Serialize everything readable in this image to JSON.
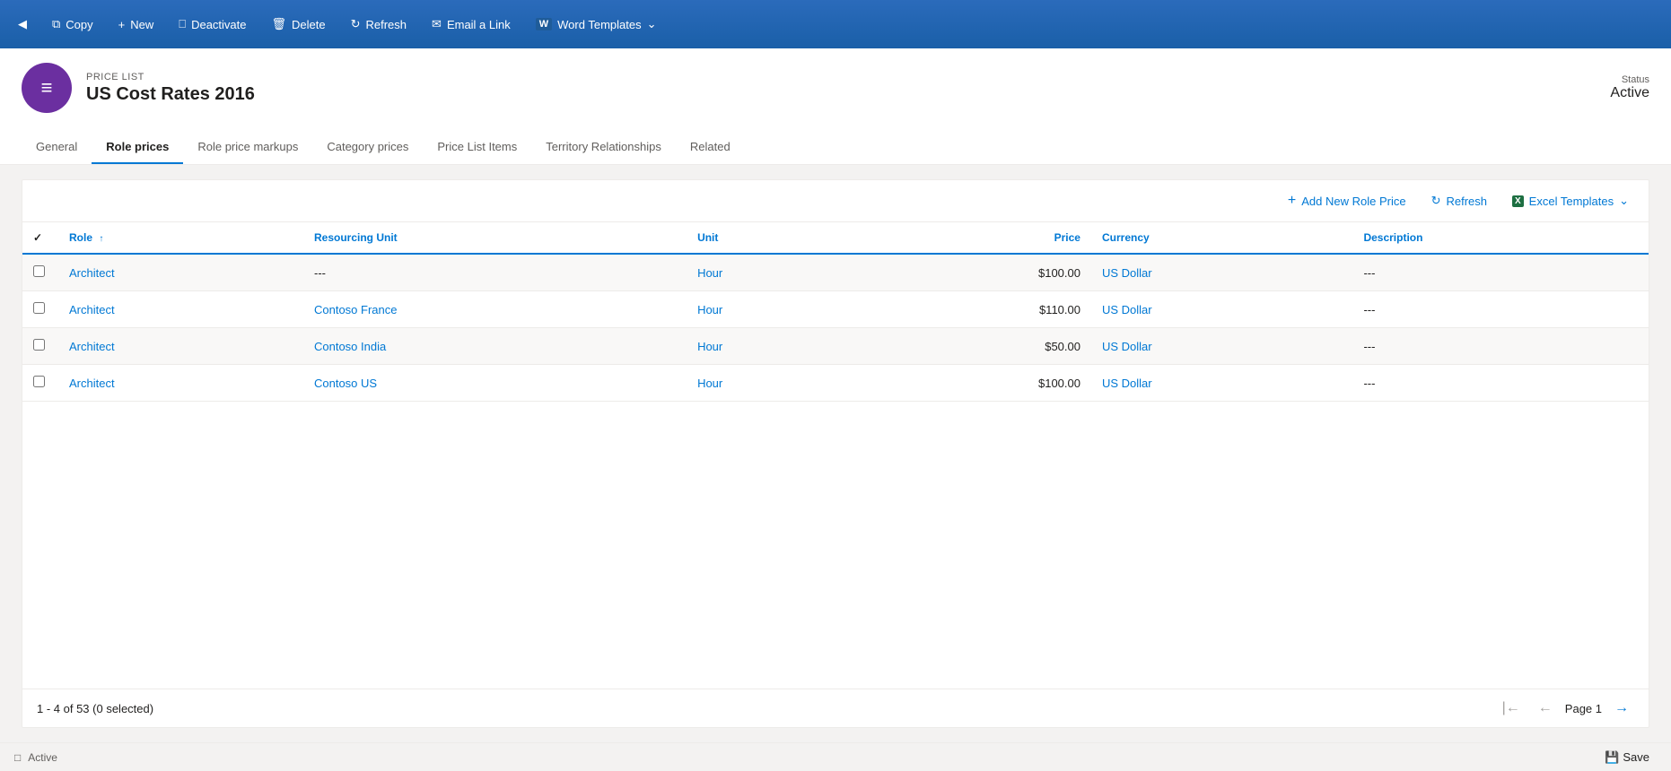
{
  "toolbar": {
    "items": [
      {
        "id": "copy",
        "label": "Copy",
        "icon": "⧉"
      },
      {
        "id": "new",
        "label": "New",
        "icon": "+"
      },
      {
        "id": "deactivate",
        "label": "Deactivate",
        "icon": "⊘"
      },
      {
        "id": "delete",
        "label": "Delete",
        "icon": "🗑"
      },
      {
        "id": "refresh",
        "label": "Refresh",
        "icon": "↺"
      },
      {
        "id": "email",
        "label": "Email a Link",
        "icon": "✉"
      },
      {
        "id": "word",
        "label": "Word Templates",
        "icon": "W"
      }
    ]
  },
  "record": {
    "type": "PRICE LIST",
    "title": "US Cost Rates 2016",
    "status_label": "Status",
    "status_value": "Active",
    "avatar_icon": "≡"
  },
  "tabs": [
    {
      "id": "general",
      "label": "General",
      "active": false
    },
    {
      "id": "role-prices",
      "label": "Role prices",
      "active": true
    },
    {
      "id": "role-price-markups",
      "label": "Role price markups",
      "active": false
    },
    {
      "id": "category-prices",
      "label": "Category prices",
      "active": false
    },
    {
      "id": "price-list-items",
      "label": "Price List Items",
      "active": false
    },
    {
      "id": "territory-relationships",
      "label": "Territory Relationships",
      "active": false
    },
    {
      "id": "related",
      "label": "Related",
      "active": false
    }
  ],
  "grid": {
    "toolbar": {
      "add_label": "Add New Role Price",
      "refresh_label": "Refresh",
      "excel_label": "Excel Templates"
    },
    "columns": [
      {
        "id": "check",
        "label": "",
        "type": "check"
      },
      {
        "id": "role",
        "label": "Role",
        "sortable": true
      },
      {
        "id": "resourcing-unit",
        "label": "Resourcing Unit",
        "sortable": false
      },
      {
        "id": "unit",
        "label": "Unit",
        "sortable": false
      },
      {
        "id": "price",
        "label": "Price",
        "align": "right",
        "sortable": false
      },
      {
        "id": "currency",
        "label": "Currency",
        "sortable": false
      },
      {
        "id": "description",
        "label": "Description",
        "sortable": false
      }
    ],
    "rows": [
      {
        "role": "Architect",
        "resourcing_unit": "---",
        "unit": "Hour",
        "price": "$100.00",
        "currency": "US Dollar",
        "description": "---"
      },
      {
        "role": "Architect",
        "resourcing_unit": "Contoso France",
        "unit": "Hour",
        "price": "$110.00",
        "currency": "US Dollar",
        "description": "---"
      },
      {
        "role": "Architect",
        "resourcing_unit": "Contoso India",
        "unit": "Hour",
        "price": "$50.00",
        "currency": "US Dollar",
        "description": "---"
      },
      {
        "role": "Architect",
        "resourcing_unit": "Contoso US",
        "unit": "Hour",
        "price": "$100.00",
        "currency": "US Dollar",
        "description": "---"
      }
    ],
    "pagination": {
      "summary": "1 - 4 of 53 (0 selected)",
      "page_label": "Page 1"
    }
  },
  "status_bar": {
    "status": "Active",
    "save_label": "Save"
  }
}
